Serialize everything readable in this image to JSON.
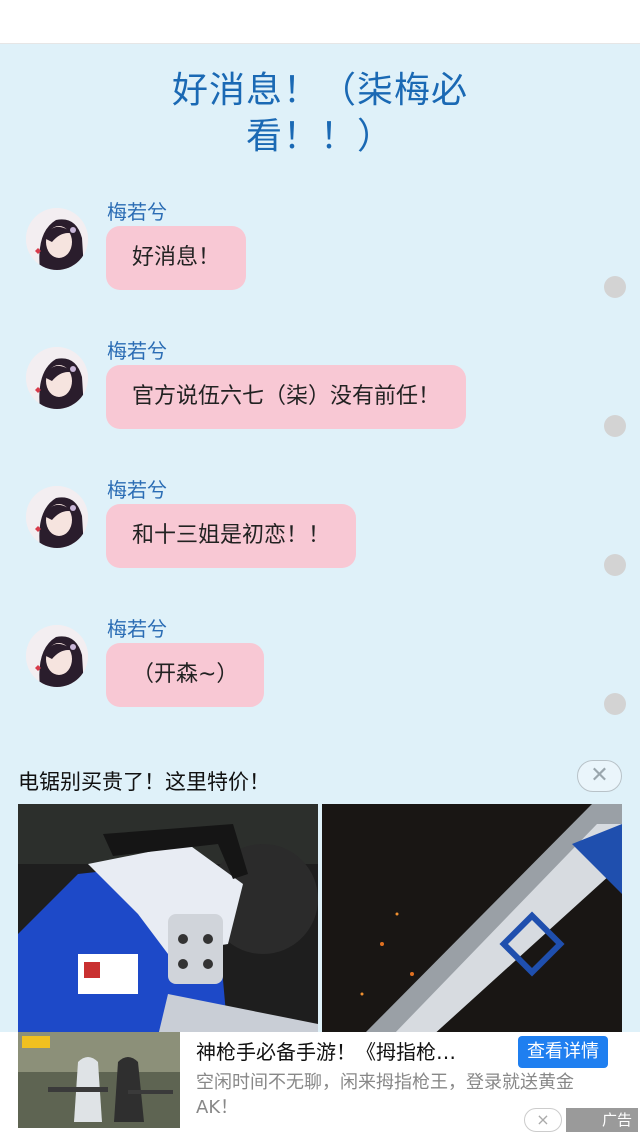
{
  "page": {
    "title": "好消息！（柒梅必看！！）"
  },
  "messages": [
    {
      "sender": "梅若兮",
      "text": "好消息！"
    },
    {
      "sender": "梅若兮",
      "text": "官方说伍六七（柒）没有前任！"
    },
    {
      "sender": "梅若兮",
      "text": "和十三姐是初恋！！"
    },
    {
      "sender": "梅若兮",
      "text": "（开森~）"
    }
  ],
  "ad_top": {
    "title": "电锯别买贵了！这里特价！",
    "close_icon": "close-icon"
  },
  "ad_bottom": {
    "title": "神枪手必备手游！《拇指枪…",
    "cta": "查看详情",
    "desc": "空闲时间不无聊，闲来拇指枪王，登录就送黄金AK！",
    "badge": "广告",
    "close": "×"
  },
  "colors": {
    "background": "#dff1f9",
    "bubble": "#f8c8d4",
    "title": "#1a69b4",
    "cta": "#1f7ff0"
  }
}
